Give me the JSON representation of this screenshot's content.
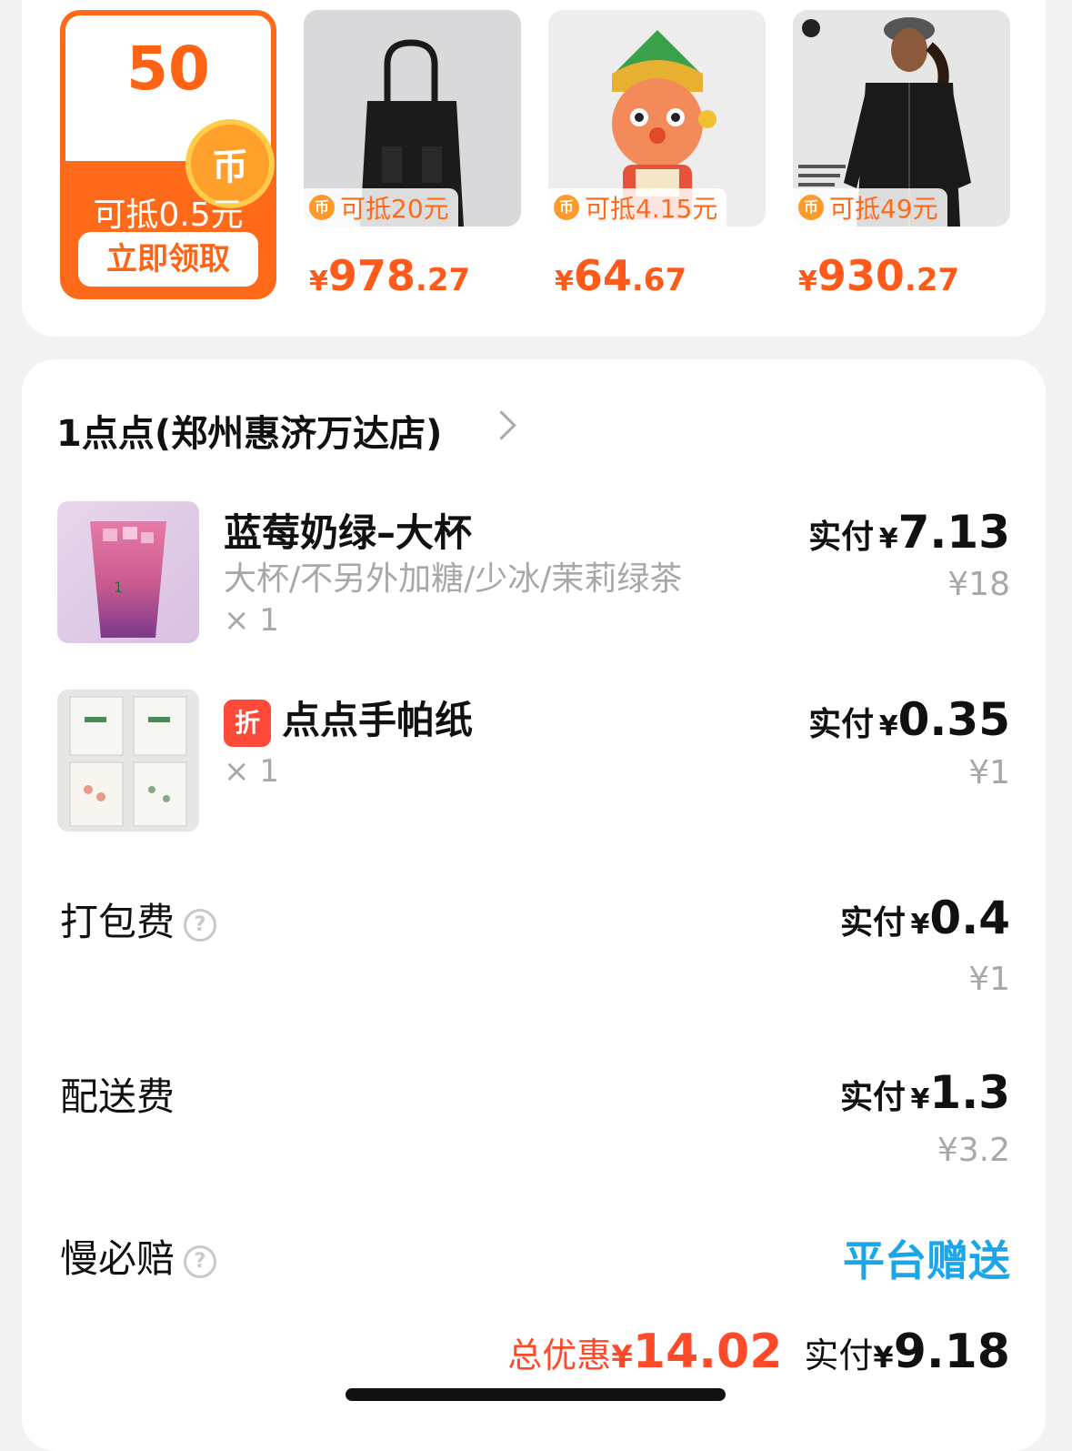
{
  "coupon": {
    "amount": "50",
    "coin_glyph": "币",
    "worth": "可抵0.5元",
    "claim_label": "立即领取"
  },
  "products": [
    {
      "icon": "tote-bag-image",
      "badge": "可抵20元",
      "currency": "¥",
      "price_int": "978",
      "price_dec": ".27"
    },
    {
      "icon": "figurine-image",
      "badge": "可抵4.15元",
      "currency": "¥",
      "price_int": "64",
      "price_dec": ".67"
    },
    {
      "icon": "jacket-model-image",
      "badge": "可抵49元",
      "currency": "¥",
      "price_int": "930",
      "price_dec": ".27"
    }
  ],
  "order": {
    "store": "1点点(郑州惠济万达店)",
    "items": [
      {
        "icon": "bubble-tea-image",
        "name": "蓝莓奶绿–大杯",
        "spec": "大杯/不另外加糖/少冰/茉莉绿茶",
        "qty": "× 1",
        "paid_label": "实付",
        "currency": "¥",
        "paid": "7.13",
        "original": "¥18"
      },
      {
        "icon": "tissue-box-image",
        "tag": "折",
        "name": "点点手帕纸",
        "qty": "× 1",
        "paid_label": "实付",
        "currency": "¥",
        "paid": "0.35",
        "original": "¥1"
      }
    ],
    "fees": [
      {
        "label": "打包费",
        "has_help": true,
        "paid_label": "实付",
        "currency": "¥",
        "paid": "0.4",
        "original": "¥1"
      },
      {
        "label": "配送费",
        "has_help": false,
        "paid_label": "实付",
        "currency": "¥",
        "paid": "1.3",
        "original": "¥3.2"
      }
    ],
    "slow_guarantee": {
      "label": "慢必赔",
      "value": "平台赠送"
    },
    "summary": {
      "discount_label": "总优惠",
      "discount_currency": "¥",
      "discount": "14.02",
      "paid_label": "实付",
      "paid_currency": "¥",
      "paid": "9.18"
    }
  },
  "help_glyph": "?",
  "colors": {
    "accent_orange": "#ff6a1a",
    "discount_red": "#ff4a2a",
    "gift_blue": "#1aa6e8",
    "muted_gray": "#a8a8a8"
  }
}
